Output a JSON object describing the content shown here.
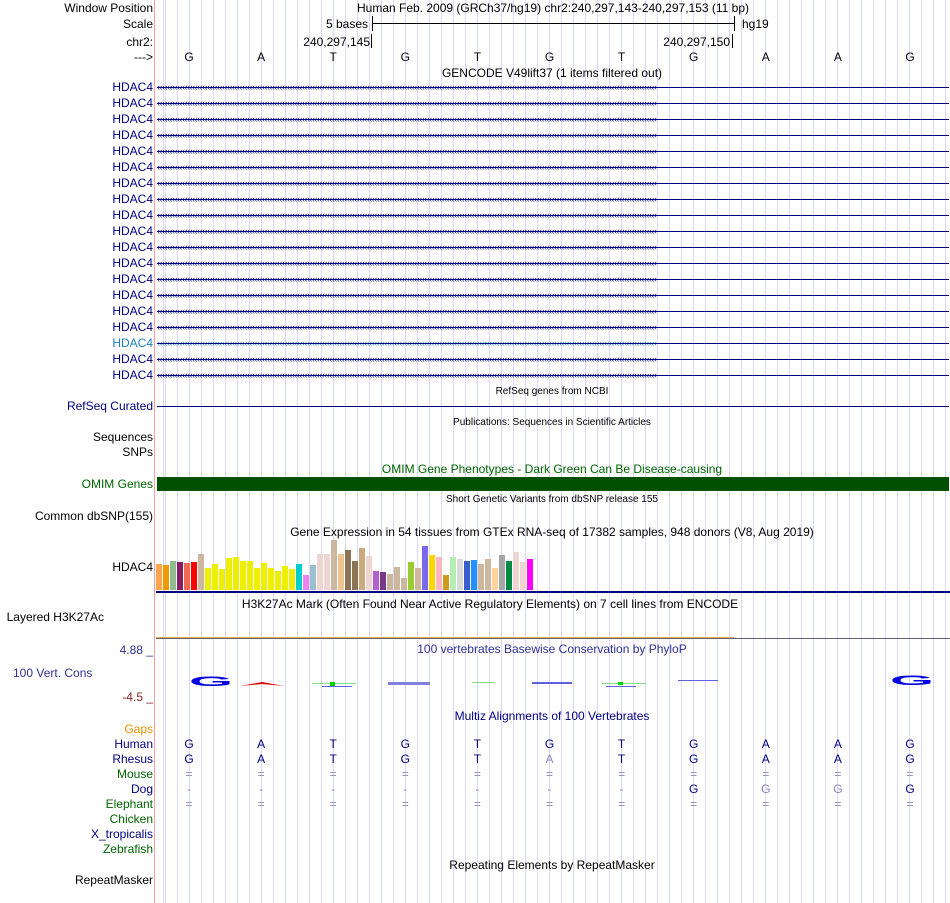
{
  "header": {
    "window_position_label": "Window Position",
    "window_position": "Human Feb. 2009 (GRCh37/hg19)   chr2:240,297,143-240,297,153 (11 bp)",
    "scale_label": "Scale",
    "scale_text": "5 bases",
    "assembly": "hg19",
    "chrom_label": "chr2:",
    "pos_left": "240,297,145",
    "pos_right": "240,297,150",
    "strand_label": "--->"
  },
  "bases": [
    "G",
    "A",
    "T",
    "G",
    "T",
    "G",
    "T",
    "G",
    "A",
    "A",
    "G"
  ],
  "gencode": {
    "title": "GENCODE V49lift37 (1 items filtered out)",
    "gene": "HDAC4",
    "count": 19,
    "highlight_index": 16
  },
  "refseq": {
    "title": "RefSeq genes from NCBI",
    "label": "RefSeq Curated"
  },
  "pubs": {
    "title": "Publications: Sequences in Scientific Articles",
    "labels": [
      "Sequences",
      "SNPs"
    ]
  },
  "omim": {
    "title": "OMIM Gene Phenotypes - Dark Green Can Be Disease-causing",
    "label": "OMIM Genes",
    "color": "#005000"
  },
  "dbsnp": {
    "title": "Short Genetic Variants from dbSNP release 155",
    "label": "Common dbSNP(155)"
  },
  "gtex": {
    "title": "Gene Expression in 54 tissues from GTEx RNA-seq of 17382 samples, 948 donors (V8, Aug 2019)",
    "label": "HDAC4",
    "values": [
      78,
      75,
      87,
      84,
      81,
      84,
      108,
      66,
      78,
      63,
      96,
      99,
      87,
      87,
      66,
      81,
      66,
      57,
      72,
      63,
      78,
      45,
      75,
      108,
      108,
      150,
      108,
      120,
      87,
      126,
      102,
      57,
      54,
      48,
      69,
      36,
      84,
      66,
      132,
      105,
      99,
      45,
      99,
      93,
      87,
      90,
      78,
      93,
      66,
      105,
      87,
      114,
      84,
      93
    ],
    "colors": [
      "#ffa54f",
      "#ee9a00",
      "#8fbc8f",
      "#8b1c62",
      "#ee6a50",
      "#ff0000",
      "#cdb79e",
      "#eeee00",
      "#eeee00",
      "#eeee00",
      "#eeee00",
      "#eeee00",
      "#eeee00",
      "#eeee00",
      "#eeee00",
      "#eeee00",
      "#eeee00",
      "#eeee00",
      "#eeee00",
      "#eeee00",
      "#00cdcd",
      "#ee82ee",
      "#9ac0cd",
      "#eed5d2",
      "#eed5d2",
      "#cdb79e",
      "#eec591",
      "#8b7355",
      "#8b7355",
      "#cdaa7d",
      "#eed5d2",
      "#b460cd",
      "#7a378b",
      "#cdb79e",
      "#cdb79e",
      "#cdb79e",
      "#9acd32",
      "#cdb79e",
      "#7b68ee",
      "#ffd700",
      "#ffb6c1",
      "#cd9b1d",
      "#b4eeb4",
      "#d9d9d9",
      "#3a5fcd",
      "#1e90ff",
      "#cdb79e",
      "#cdb79e",
      "#ffd39b",
      "#a6a6a6",
      "#008b45",
      "#eed5d2",
      "#eed5d2",
      "#ff00ff"
    ]
  },
  "h3k27ac": {
    "title": "H3K27Ac Mark (Often Found Near Active Regulatory Elements) on 7 cell lines from ENCODE",
    "label": "Layered H3K27Ac"
  },
  "phylop": {
    "title": "100 vertebrates Basewise Conservation by PhyloP",
    "label": "100 Vert. Cons",
    "max": "4.88 _",
    "min": "-4.5 _"
  },
  "multiz": {
    "title": "Multiz Alignments of 100 Vertebrates",
    "gaps_label": "Gaps",
    "species": [
      {
        "name": "Human",
        "color": "#000080",
        "bases": [
          "G",
          "A",
          "T",
          "G",
          "T",
          "G",
          "T",
          "G",
          "A",
          "A",
          "G"
        ]
      },
      {
        "name": "Rhesus",
        "color": "#000080",
        "bases": [
          "G",
          "A",
          "T",
          "G",
          "T",
          "A",
          "T",
          "G",
          "A",
          "A",
          "G"
        ],
        "faded": [
          5
        ]
      },
      {
        "name": "Mouse",
        "color": "#006400",
        "bases": [
          "=",
          "=",
          "=",
          "=",
          "=",
          "=",
          "=",
          "=",
          "=",
          "=",
          "="
        ],
        "faded": [
          0,
          1,
          2,
          3,
          4,
          5,
          6,
          7,
          8,
          9,
          10
        ]
      },
      {
        "name": "Dog",
        "color": "#000080",
        "bases": [
          "-",
          "-",
          "-",
          "-",
          "-",
          "-",
          "-",
          "G",
          "G",
          "G",
          "G"
        ],
        "faded": [
          0,
          1,
          2,
          3,
          4,
          5,
          6,
          8,
          9
        ]
      },
      {
        "name": "Elephant",
        "color": "#006400",
        "bases": [
          "=",
          "=",
          "=",
          "=",
          "=",
          "=",
          "=",
          "=",
          "=",
          "=",
          "="
        ],
        "faded": [
          0,
          1,
          2,
          3,
          4,
          5,
          6,
          7,
          8,
          9,
          10
        ]
      },
      {
        "name": "Chicken",
        "color": "#006400",
        "bases": []
      },
      {
        "name": "X_tropicalis",
        "color": "#000080",
        "bases": []
      },
      {
        "name": "Zebrafish",
        "color": "#006400",
        "bases": []
      }
    ]
  },
  "repeatmasker": {
    "title": "Repeating Elements by RepeatMasker",
    "label": "RepeatMasker"
  }
}
